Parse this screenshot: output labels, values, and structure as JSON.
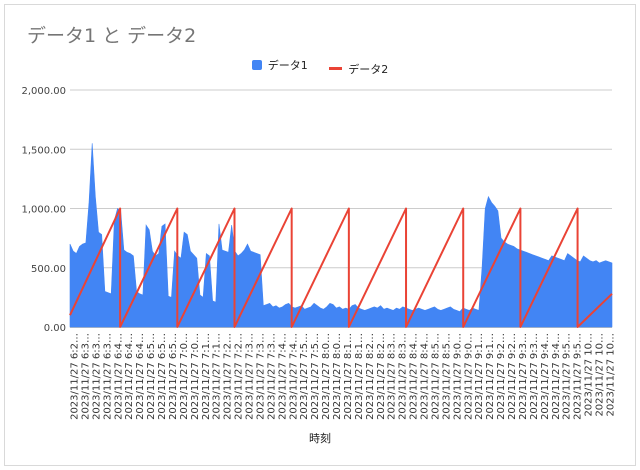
{
  "chart_data": {
    "type": "line",
    "title": "データ1 と データ2",
    "xlabel": "時刻",
    "ylabel": "",
    "ylim": [
      0,
      2000
    ],
    "y_ticks": [
      0,
      500,
      1000,
      1500,
      2000
    ],
    "y_tick_labels": [
      "0.00",
      "500.00",
      "1,000.00",
      "1,500.00",
      "2,000.00"
    ],
    "grid": true,
    "legend_position": "top",
    "x_tick_labels": [
      "2023/11/27 6:2…",
      "2023/11/27 6:3…",
      "2023/11/27 6:3…",
      "2023/11/27 6:3…",
      "2023/11/27 6:4…",
      "2023/11/27 6:4…",
      "2023/11/27 6:4…",
      "2023/11/27 6:5…",
      "2023/11/27 6:5…",
      "2023/11/27 6:5…",
      "2023/11/27 7:0…",
      "2023/11/27 7:0…",
      "2023/11/27 7:1…",
      "2023/11/27 7:1…",
      "2023/11/27 7:2…",
      "2023/11/27 7:2…",
      "2023/11/27 7:3…",
      "2023/11/27 7:3…",
      "2023/11/27 7:3…",
      "2023/11/27 7:4…",
      "2023/11/27 7:4…",
      "2023/11/27 7:5…",
      "2023/11/27 7:5…",
      "2023/11/27 8:0…",
      "2023/11/27 8:0…",
      "2023/11/27 8:1…",
      "2023/11/27 8:1…",
      "2023/11/27 8:2…",
      "2023/11/27 8:2…",
      "2023/11/27 8:3…",
      "2023/11/27 8:3…",
      "2023/11/27 8:4…",
      "2023/11/27 8:4…",
      "2023/11/27 8:5…",
      "2023/11/27 8:5…",
      "2023/11/27 9:0…",
      "2023/11/27 9:0…",
      "2023/11/27 9:1…",
      "2023/11/27 9:1…",
      "2023/11/27 9:2…",
      "2023/11/27 9:2…",
      "2023/11/27 9:3…",
      "2023/11/27 9:3…",
      "2023/11/27 9:4…",
      "2023/11/27 9:4…",
      "2023/11/27 9:5…",
      "2023/11/27 9:5…",
      "2023/11/27 10…",
      "2023/11/27 10…",
      "2023/11/27 10…"
    ],
    "series": [
      {
        "name": "データ1",
        "type": "area",
        "color": "#4285f4",
        "values": [
          700,
          640,
          620,
          680,
          700,
          710,
          1050,
          1550,
          1100,
          800,
          780,
          300,
          290,
          280,
          900,
          1000,
          980,
          650,
          630,
          620,
          600,
          300,
          280,
          270,
          860,
          820,
          640,
          600,
          620,
          850,
          870,
          260,
          250,
          640,
          600,
          580,
          800,
          780,
          640,
          610,
          580,
          270,
          250,
          620,
          600,
          220,
          210,
          870,
          650,
          640,
          630,
          860,
          640,
          600,
          620,
          650,
          700,
          640,
          630,
          620,
          610,
          180,
          190,
          200,
          170,
          180,
          160,
          170,
          190,
          200,
          170,
          160,
          170,
          180,
          150,
          160,
          170,
          200,
          180,
          160,
          150,
          170,
          200,
          190,
          160,
          170,
          150,
          160,
          150,
          180,
          190,
          160,
          150,
          140,
          150,
          160,
          170,
          160,
          180,
          150,
          160,
          150,
          140,
          160,
          150,
          170,
          160,
          150,
          140,
          150,
          160,
          150,
          140,
          150,
          160,
          170,
          150,
          140,
          150,
          160,
          170,
          150,
          140,
          130,
          160,
          150,
          140,
          160,
          150,
          140,
          500,
          1000,
          1100,
          1050,
          1020,
          980,
          750,
          720,
          700,
          690,
          680,
          660,
          650,
          640,
          630,
          620,
          610,
          600,
          590,
          580,
          570,
          560,
          600,
          590,
          580,
          570,
          560,
          620,
          600,
          580,
          560,
          550,
          600,
          580,
          560,
          550,
          560,
          540,
          550,
          560,
          550,
          540
        ]
      },
      {
        "name": "データ2",
        "type": "line",
        "color": "#ea4335",
        "x": [
          0,
          0.0925,
          0.0925,
          0.198,
          0.198,
          0.3035,
          0.3035,
          0.409,
          0.409,
          0.5145,
          0.5145,
          0.62,
          0.62,
          0.7255,
          0.7255,
          0.831,
          0.831,
          0.9365,
          0.9365,
          1.0
        ],
        "values": [
          100,
          1000,
          0,
          1000,
          0,
          1000,
          0,
          1000,
          0,
          1000,
          0,
          1000,
          0,
          1000,
          0,
          1000,
          0,
          1000,
          0,
          280
        ]
      }
    ]
  }
}
